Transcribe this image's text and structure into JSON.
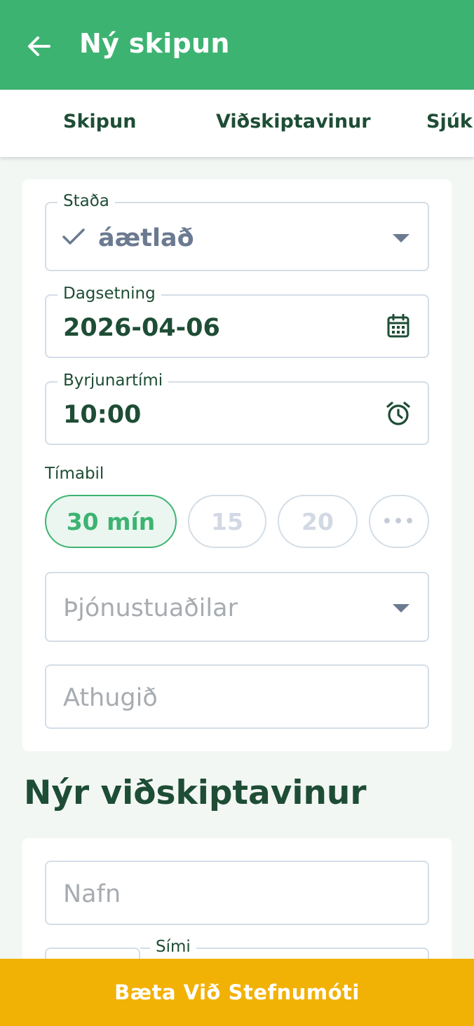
{
  "appbar": {
    "title": "Ný skipun",
    "back_icon": "arrow-left-icon"
  },
  "tabs": [
    {
      "label": "Skipun"
    },
    {
      "label": "Viðskiptavinur"
    },
    {
      "label": "Sjúklingur"
    }
  ],
  "appointment": {
    "status": {
      "label": "Staða",
      "value": "áætlað",
      "icon": "check-icon"
    },
    "date": {
      "label": "Dagsetning",
      "value": "2026-04-06",
      "icon": "calendar-icon"
    },
    "start_time": {
      "label": "Byrjunartími",
      "value": "10:00",
      "icon": "alarm-clock-icon"
    },
    "duration": {
      "label": "Tímabil",
      "options": [
        "30 mín",
        "15",
        "20",
        "•••"
      ],
      "selected": "30 mín"
    },
    "providers": {
      "placeholder": "Þjónustuaðilar"
    },
    "note": {
      "placeholder": "Athugið"
    }
  },
  "new_client": {
    "title": "Nýr viðskiptavinur",
    "name": {
      "placeholder": "Nafn"
    },
    "phone": {
      "label": "Sími"
    }
  },
  "submit_button": {
    "label": "Bæta Við Stefnumóti"
  },
  "colors": {
    "primary": "#3db372",
    "accent": "#f2b105",
    "text": "#1e4d35"
  }
}
